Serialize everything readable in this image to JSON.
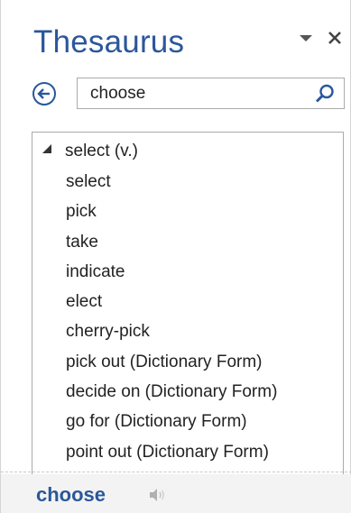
{
  "pane": {
    "title": "Thesaurus"
  },
  "search": {
    "value": "choose"
  },
  "results": {
    "group_label": "select (v.)",
    "synonyms": [
      "select",
      "pick",
      "take",
      "indicate",
      "elect",
      "cherry-pick",
      "pick out (Dictionary Form)",
      "decide on (Dictionary Form)",
      "go for (Dictionary Form)",
      "point out (Dictionary Form)"
    ]
  },
  "footer": {
    "word": "choose"
  },
  "icons": {
    "options": "chevron-down-icon",
    "close": "close-icon",
    "back": "back-arrow-icon",
    "search": "search-icon",
    "expand": "expand-triangle-icon",
    "speaker": "speaker-icon"
  },
  "colors": {
    "accent": "#2b579a",
    "text": "#222222",
    "footer_bg": "#f3f3f3",
    "border": "#ababab"
  }
}
